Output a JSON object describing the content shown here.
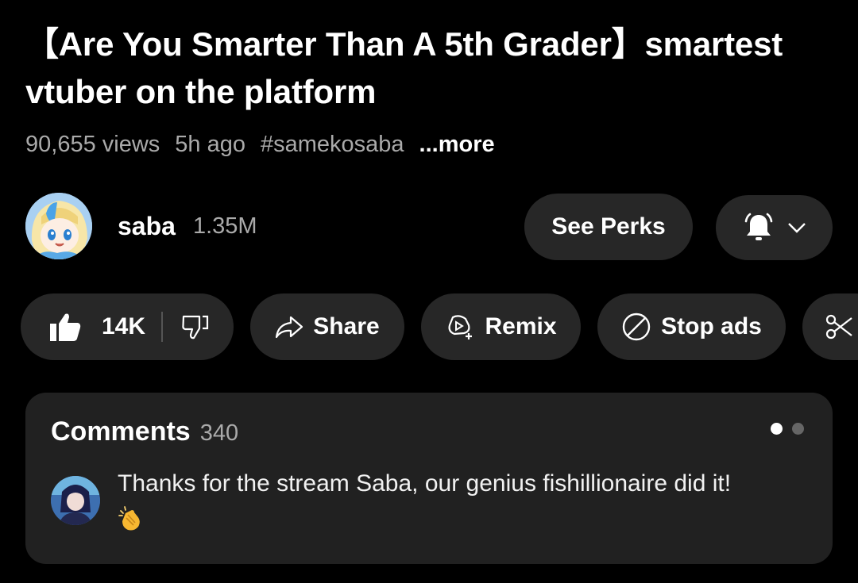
{
  "video": {
    "title": "【Are You Smarter Than A 5th Grader】smartest vtuber on the platform",
    "views": "90,655 views",
    "age": "5h ago",
    "hashtag": "#samekosaba",
    "more_label": "...more"
  },
  "channel": {
    "name": "saba",
    "subscribers": "1.35M",
    "perks_label": "See Perks"
  },
  "actions": {
    "like_count": "14K",
    "share_label": "Share",
    "remix_label": "Remix",
    "stop_ads_label": "Stop ads"
  },
  "comments": {
    "title": "Comments",
    "count": "340",
    "top_comment": {
      "text": "Thanks for the stream Saba, our genius fishillionaire did it!",
      "emoji_icon": "clapping-hands-icon"
    },
    "pager": {
      "active_index": 0,
      "total": 2
    }
  },
  "icons": {
    "like": "thumbs-up-icon",
    "dislike": "thumbs-down-icon",
    "share": "share-arrow-icon",
    "remix": "remix-icon",
    "stop_ads": "prohibited-icon",
    "clip": "scissors-icon",
    "notifications": "bell-icon",
    "dropdown": "chevron-down-icon"
  },
  "colors": {
    "background": "#000000",
    "pill": "#272727",
    "card": "#212121",
    "secondary_text": "#aaaaaa"
  }
}
